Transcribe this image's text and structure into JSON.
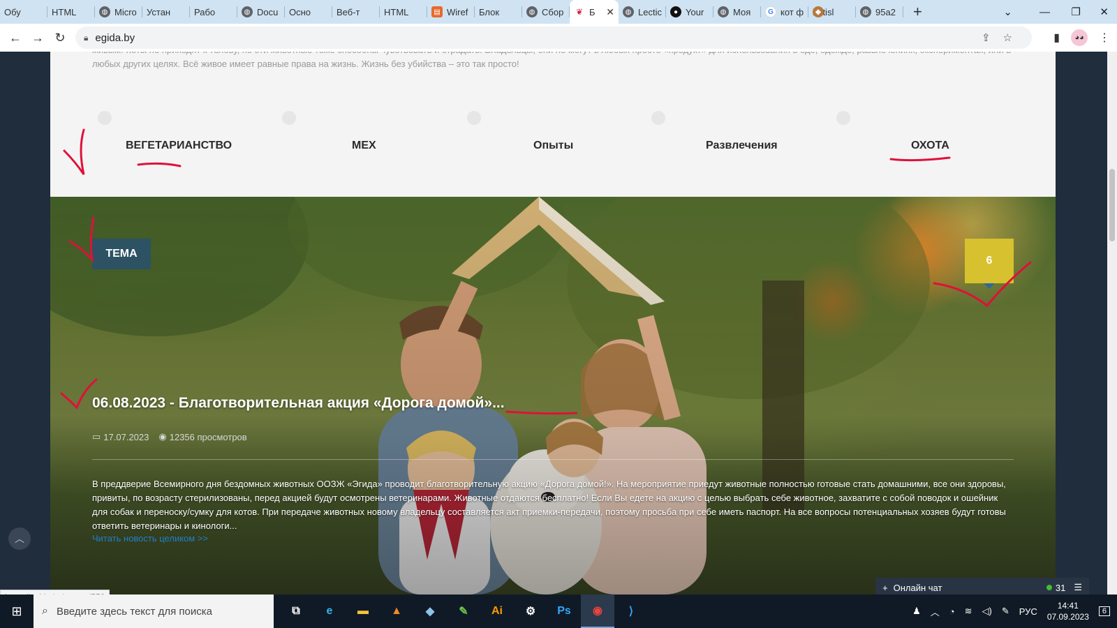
{
  "browser": {
    "tabs": [
      {
        "label": "Обу",
        "icon": "chatgpt-icon"
      },
      {
        "label": "HTML",
        "icon": "chatgpt-icon"
      },
      {
        "label": "Micro",
        "icon": "globe-icon"
      },
      {
        "label": "Устан",
        "icon": "chatgpt-icon"
      },
      {
        "label": "Рабо",
        "icon": "chatgpt-icon"
      },
      {
        "label": "Docu",
        "icon": "globe-icon"
      },
      {
        "label": "Осно",
        "icon": "chatgpt-icon"
      },
      {
        "label": "Веб-т",
        "icon": "chatgpt-icon"
      },
      {
        "label": "HTML",
        "icon": "chatgpt-icon"
      },
      {
        "label": "Wiref",
        "icon": "wireframe-icon"
      },
      {
        "label": "Блок",
        "icon": "chatgpt-icon"
      },
      {
        "label": "Сбор",
        "icon": "globe-icon"
      },
      {
        "label": "Б",
        "icon": "paw-icon",
        "active": true
      },
      {
        "label": "Lectic",
        "icon": "globe-icon"
      },
      {
        "label": "Your",
        "icon": "github-icon"
      },
      {
        "label": "Моя",
        "icon": "globe-icon"
      },
      {
        "label": "кот ф",
        "icon": "google-icon"
      },
      {
        "label": "britisl",
        "icon": "cat-icon"
      },
      {
        "label": "95a2",
        "icon": "globe-icon"
      }
    ],
    "new_tab": "+",
    "url": "egida.by",
    "status_url": "https://egida.by/events/553"
  },
  "page": {
    "intro_text": "живым. Коты не приходят к телову, но эти животные тоже способны чувствовать и страдать. Владельцы, они не могут в любых просто «продукт» для использования в еде, одежде, развлечениях, экспериментах, или в любых других целях. Всё живое имеет равные права на жизнь. Жизнь без убийства – это так просто!",
    "categories": [
      "ВЕГЕТАРИАНСТВО",
      "МЕХ",
      "Опыты",
      "Развлечения",
      "ОХОТА"
    ],
    "hero": {
      "tag": "ТЕМА",
      "counter": "6",
      "headline": "06.08.2023 - Благотворительная акция «Дорога домой»...",
      "date": "17.07.2023",
      "views": "12356 просмотров",
      "excerpt": "В преддверие Всемирного дня бездомных животных ООЗЖ «Эгида» проводит благотворительную акцию «Дорога домой!». На мероприятие приедут животные полностью готовые стать домашними, все они здоровы, привиты, по возрасту стерилизованы, перед акцией будут осмотрены ветеринарами. Животные отдаются бесплатно! Если Вы едете на акцию с целью выбрать себе животное, захватите с собой поводок и ошейник для собак и переноску/сумку для котов. При передаче животных новому владельцу составляется акт приемки-передачи, поэтому просьба при себе иметь паспорт. На все вопросы потенциальных хозяев будут готовы ответить ветеринары и кинологи...",
      "read_more": "Читать новость целиком >>"
    },
    "chat": {
      "label": "Онлайн чат",
      "plus": "+",
      "online_count": "31"
    }
  },
  "taskbar": {
    "search_placeholder": "Введите здесь текст для поиска",
    "apps": [
      {
        "name": "task-view-icon",
        "glyph": "⧉",
        "color": "#ffffff"
      },
      {
        "name": "edge-icon",
        "glyph": "e",
        "color": "#35b3e8"
      },
      {
        "name": "file-explorer-icon",
        "glyph": "▬",
        "color": "#f3c33c"
      },
      {
        "name": "vlc-icon",
        "glyph": "▲",
        "color": "#f08a24"
      },
      {
        "name": "notepad-icon",
        "glyph": "◆",
        "color": "#8fc3e8"
      },
      {
        "name": "greenshot-icon",
        "glyph": "✎",
        "color": "#6cc04a"
      },
      {
        "name": "illustrator-icon",
        "glyph": "Ai",
        "color": "#ff9a00"
      },
      {
        "name": "settings-icon",
        "glyph": "⚙",
        "color": "#ffffff"
      },
      {
        "name": "photoshop-icon",
        "glyph": "Ps",
        "color": "#31a8ff"
      },
      {
        "name": "chrome-icon",
        "glyph": "◉",
        "color": "#e8453c",
        "active": true
      },
      {
        "name": "vscode-icon",
        "glyph": "⟩",
        "color": "#3aa0f0"
      }
    ],
    "language": "РУС",
    "time": "14:41",
    "date": "07.09.2023",
    "notifications": "6"
  },
  "colors": {
    "annotation_red": "#e0103a",
    "counter_yellow": "#d7c12e",
    "tag_blue": "#285070",
    "link_blue": "#1f7fc9"
  }
}
